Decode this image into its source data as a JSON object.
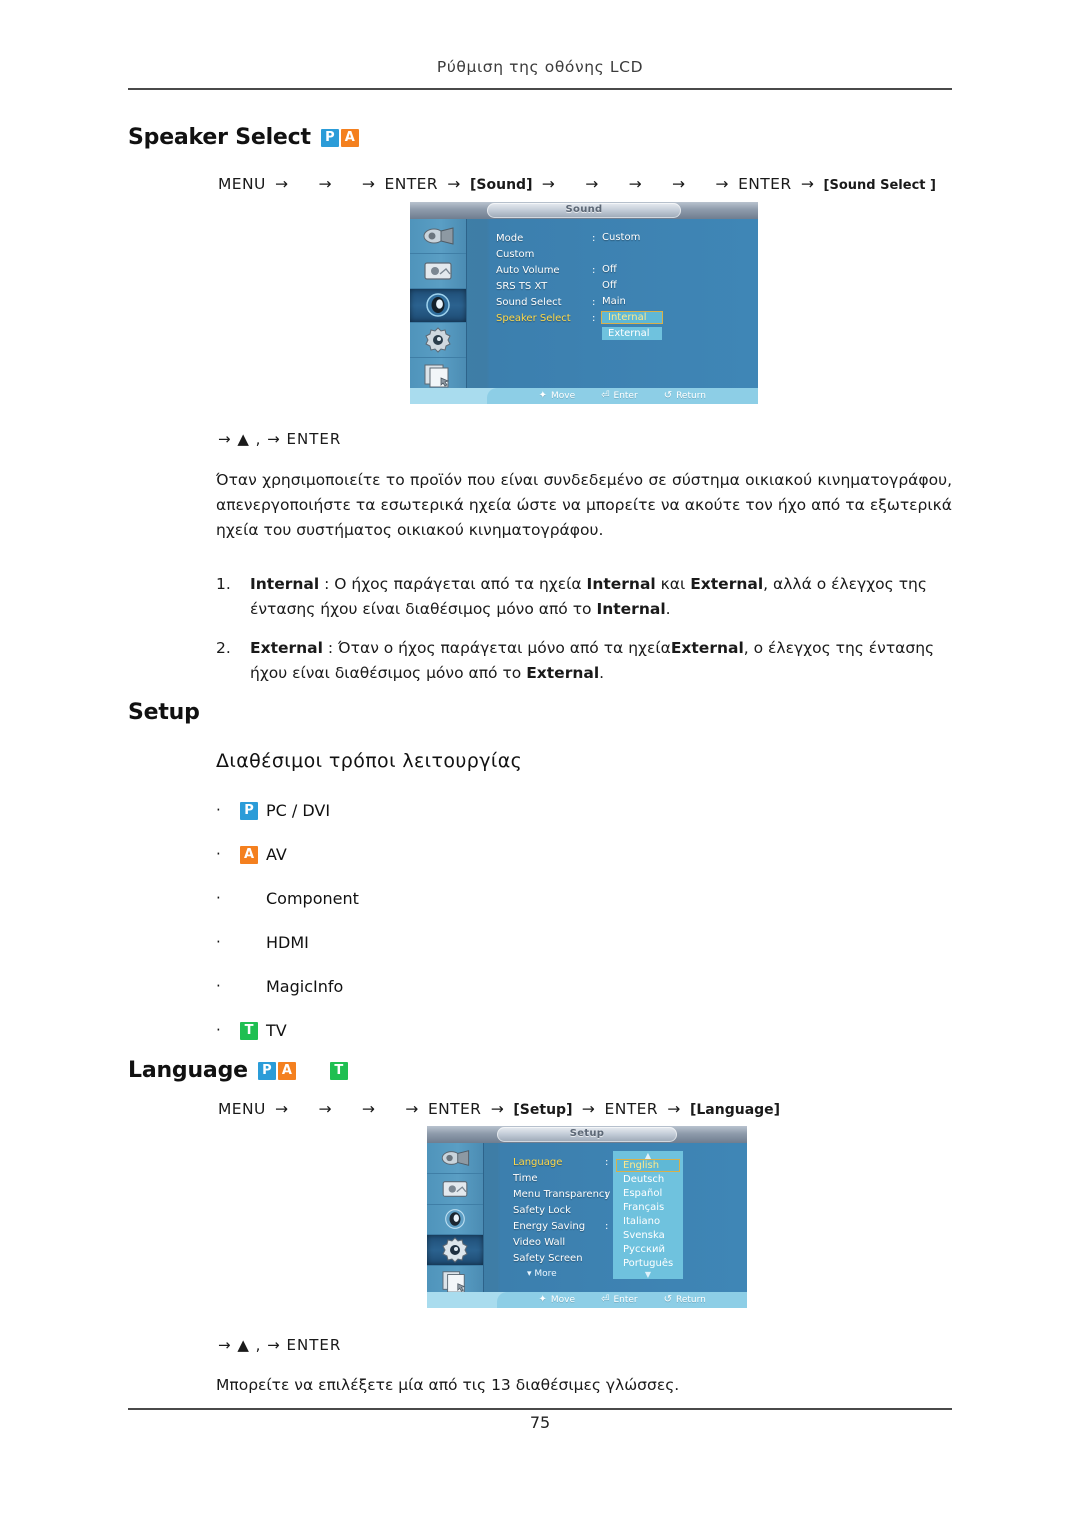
{
  "document": {
    "running_head": "Ρύθμιση της οθόνης LCD",
    "page_number": "75"
  },
  "speaker_select": {
    "title": "Speaker Select",
    "badges": [
      "P",
      "A"
    ],
    "nav": {
      "menu": "MENU",
      "enter1": "ENTER",
      "token1": "[Sound]",
      "enter2": "ENTER",
      "token2": "[Sound Select ]",
      "arrow": "→"
    },
    "enter_line": "→ ▲ ,   → ENTER",
    "paragraph": "Όταν χρησιμοποιείτε το προϊόν που είναι συνδεδεμένο σε σύστημα οικιακού κινηματογράφου, απενεργοποιήστε τα εσωτερικά ηχεία ώστε να μπορείτε να ακούτε τον ήχο από τα εξωτερικά ηχεία του συστήματος οικιακού κινηματογράφου.",
    "list": [
      {
        "number": "1.",
        "html": "<b class=\"b\">Internal</b> : Ο ήχος παράγεται από τα ηχεία <b class=\"b\">Internal</b> και <b class=\"b\">External</b>, αλλά ο έλεγχος της έντασης ήχου είναι διαθέσιμος μόνο από το <b class=\"b\">Internal</b>."
      },
      {
        "number": "2.",
        "html": "<b class=\"b\">External</b> : Όταν ο ήχος παράγεται μόνο από τα ηχεία<b class=\"b\">External</b>, ο έλεγχος της έντασης ήχου είναι διαθέσιμος μόνο από το <b class=\"b\">External</b>."
      }
    ],
    "osd": {
      "title": "Sound",
      "selected_rail_index": 2,
      "rows": [
        {
          "label": "Mode",
          "value": "Custom",
          "colon": true,
          "active": false
        },
        {
          "label": "Custom",
          "value": "",
          "colon": false,
          "active": false
        },
        {
          "label": "Auto Volume",
          "value": "Off",
          "colon": true,
          "active": false
        },
        {
          "label": "SRS TS XT",
          "value": "Off",
          "colon": false,
          "active": false
        },
        {
          "label": "Sound Select",
          "value": "Main",
          "colon": true,
          "active": false
        },
        {
          "label": "Speaker Select",
          "value": "",
          "colon": true,
          "active": true
        }
      ],
      "options": [
        {
          "label": "Internal",
          "selected": true
        },
        {
          "label": "External",
          "selected": false
        }
      ],
      "footer": [
        {
          "glyph": "✦",
          "label": "Move"
        },
        {
          "glyph": "⏎",
          "label": "Enter"
        },
        {
          "glyph": "↺",
          "label": "Return"
        }
      ]
    }
  },
  "setup": {
    "title": "Setup",
    "sub_heading": "Διαθέσιμοι τρόποι λειτουργίας",
    "modes": [
      {
        "badge": "P",
        "label": "PC / DVI"
      },
      {
        "badge": "A",
        "label": "AV"
      },
      {
        "badge": "",
        "label": "Component"
      },
      {
        "badge": "",
        "label": "HDMI"
      },
      {
        "badge": "",
        "label": "MagicInfo"
      },
      {
        "badge": "T",
        "label": "TV"
      }
    ]
  },
  "language": {
    "title": "Language",
    "badges": [
      "P",
      "A",
      "T"
    ],
    "nav": {
      "menu": "MENU",
      "enter1": "ENTER",
      "token1": "[Setup]",
      "enter2": "ENTER",
      "token2": "[Language]",
      "arrow": "→"
    },
    "enter_line": "→ ▲ ,   → ENTER",
    "paragraph": "Μπορείτε να επιλέξετε μία από τις 13 διαθέσιμες γλώσσες.",
    "osd": {
      "title": "Setup",
      "selected_rail_index": 3,
      "rows": [
        {
          "label": "Language",
          "value": "",
          "colon": true,
          "active": true
        },
        {
          "label": "Time",
          "value": "",
          "colon": false,
          "active": false
        },
        {
          "label": "Menu Transparency",
          "value": "",
          "colon": true,
          "active": false
        },
        {
          "label": "Safety Lock",
          "value": "",
          "colon": false,
          "active": false
        },
        {
          "label": "Energy Saving",
          "value": "",
          "colon": true,
          "active": false
        },
        {
          "label": "Video Wall",
          "value": "",
          "colon": false,
          "active": false
        },
        {
          "label": "Safety Screen",
          "value": "",
          "colon": false,
          "active": false
        }
      ],
      "more_label": "More",
      "languages": [
        {
          "label": "English",
          "selected": true
        },
        {
          "label": "Deutsch",
          "selected": false
        },
        {
          "label": "Español",
          "selected": false
        },
        {
          "label": "Français",
          "selected": false
        },
        {
          "label": "Italiano",
          "selected": false
        },
        {
          "label": "Svenska",
          "selected": false
        },
        {
          "label": "Русский",
          "selected": false
        },
        {
          "label": "Português",
          "selected": false
        }
      ],
      "scroll_up": "▲",
      "scroll_down": "▼",
      "footer": [
        {
          "glyph": "✦",
          "label": "Move"
        },
        {
          "glyph": "⏎",
          "label": "Enter"
        },
        {
          "glyph": "↺",
          "label": "Return"
        }
      ]
    }
  },
  "colors": {
    "badge_pc": "#2b9cd8",
    "badge_av": "#f4801f",
    "badge_tv": "#1fbf52",
    "osd_highlight": "#ffd94a",
    "osd_option_bg": "#6fc2de"
  }
}
